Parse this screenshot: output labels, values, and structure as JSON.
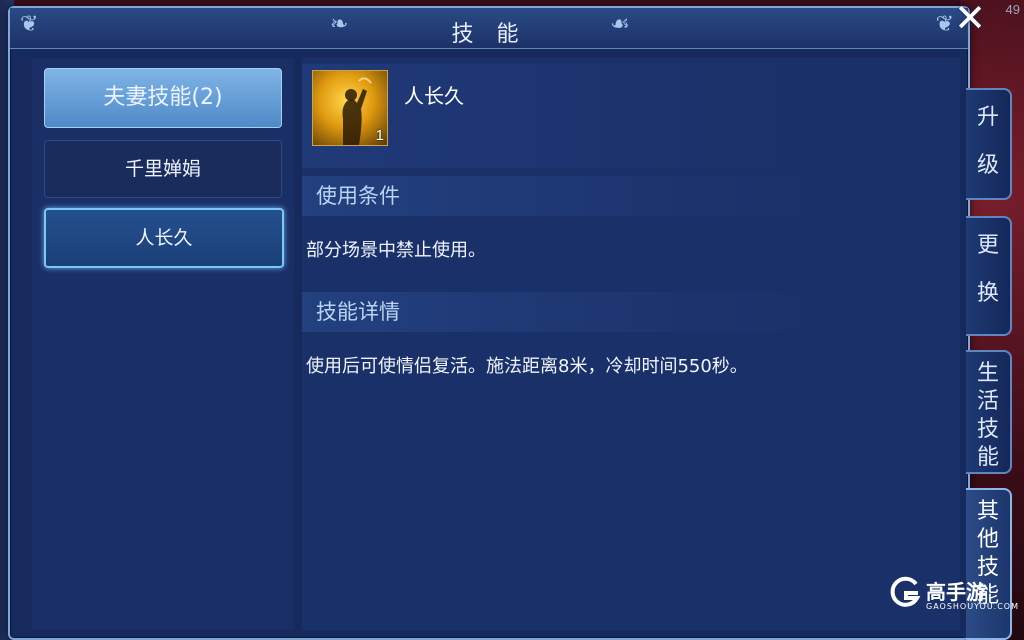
{
  "window": {
    "title": "技 能",
    "close_icon": "close-icon"
  },
  "corner_number": "49",
  "left_list": {
    "header": "夫妻技能(2)",
    "items": [
      {
        "label": "千里婵娟",
        "selected": false
      },
      {
        "label": "人长久",
        "selected": true
      }
    ]
  },
  "detail": {
    "skill_name": "人长久",
    "skill_level": "1",
    "icon": "praying-figure-icon",
    "sections": [
      {
        "title": "使用条件",
        "text": "部分场景中禁止使用。"
      },
      {
        "title": "技能详情",
        "text": "使用后可使情侣复活。施法距离8米，冷却时间550秒。"
      }
    ]
  },
  "side_tabs": [
    {
      "chars": [
        "升",
        "级"
      ]
    },
    {
      "chars": [
        "更",
        "换"
      ]
    },
    {
      "chars": [
        "生",
        "活",
        "技",
        "能"
      ]
    },
    {
      "chars": [
        "其",
        "他",
        "技",
        "能"
      ],
      "active": true
    }
  ],
  "watermark": {
    "name": "高手游",
    "url": "GAOSHOUYOU.COM"
  },
  "colors": {
    "panel": "#1a3068",
    "accent": "#7fc6f4",
    "header_button": "#6aa2da"
  }
}
